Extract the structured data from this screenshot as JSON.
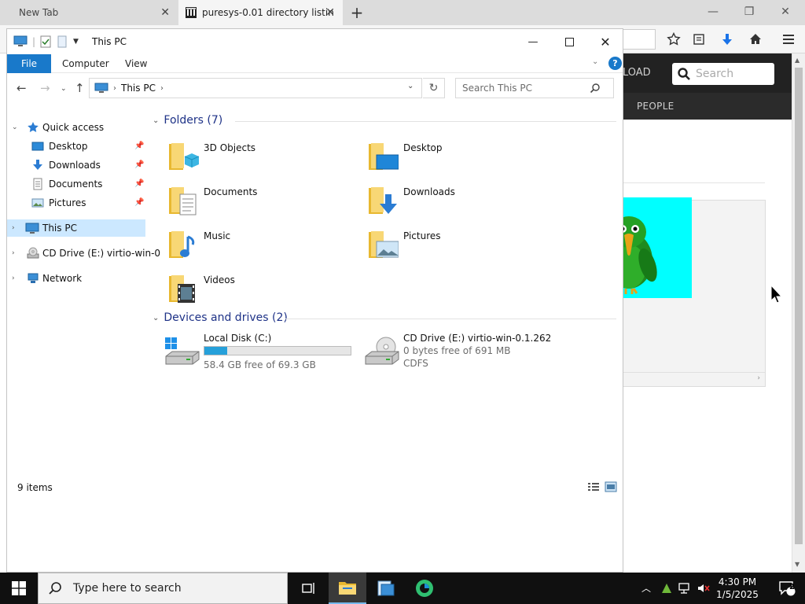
{
  "browser": {
    "tabs": [
      {
        "label": "New Tab",
        "active": false
      },
      {
        "label": "puresys-0.01 directory listin",
        "active": true
      }
    ],
    "page": {
      "nav_partial_text": "LOAD",
      "search_placeholder": "Search",
      "people_label": "PEOPLE"
    }
  },
  "explorer": {
    "title": "This PC",
    "ribbon_tabs": [
      "File",
      "Computer",
      "View"
    ],
    "help_label": "?",
    "address": {
      "location": "This PC"
    },
    "search": {
      "placeholder": "Search This PC"
    },
    "nav_pane": {
      "quick_access": {
        "label": "Quick access",
        "items": [
          {
            "label": "Desktop",
            "pinned": true
          },
          {
            "label": "Downloads",
            "pinned": true
          },
          {
            "label": "Documents",
            "pinned": true
          },
          {
            "label": "Pictures",
            "pinned": true
          }
        ]
      },
      "this_pc": {
        "label": "This PC",
        "selected": true
      },
      "cd_drive": {
        "label": "CD Drive (E:) virtio-win-0"
      },
      "network": {
        "label": "Network"
      }
    },
    "folders_group": {
      "label": "Folders (7)",
      "items": [
        "3D Objects",
        "Desktop",
        "Documents",
        "Downloads",
        "Music",
        "Pictures",
        "Videos"
      ]
    },
    "drives_group": {
      "label": "Devices and drives (2)",
      "drives": [
        {
          "name": "Local Disk (C:)",
          "free_text": "58.4 GB free of 69.3 GB",
          "used_fraction": 0.157
        },
        {
          "name": "CD Drive (E:) virtio-win-0.1.262",
          "free_text": "0 bytes free of 691 MB",
          "fs": "CDFS"
        }
      ]
    },
    "status": {
      "item_count": "9 items"
    }
  },
  "taskbar": {
    "search_placeholder": "Type here to search",
    "clock": {
      "time": "4:30 PM",
      "date": "1/5/2025"
    },
    "notification_count": "2"
  },
  "colors": {
    "accent": "#1979ca",
    "selection": "#cce8ff",
    "group_header": "#1e3287",
    "drive_bar": "#26a0da",
    "taskbar": "#101010",
    "parrot_bg": "#00ffff"
  }
}
